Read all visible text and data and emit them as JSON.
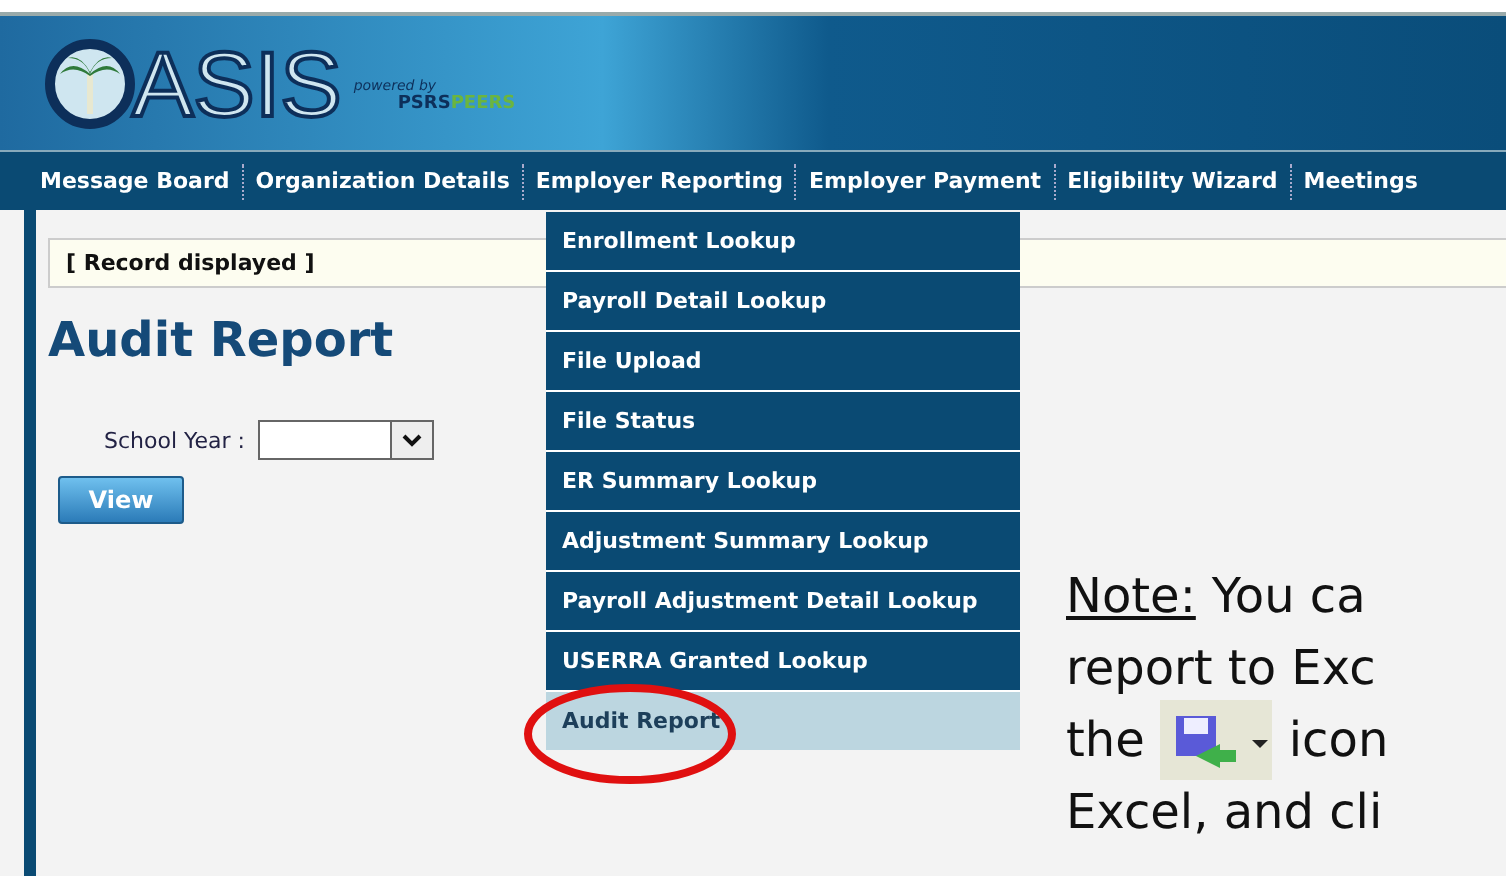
{
  "header": {
    "logo_text": "ASIS",
    "powered_by": "powered by",
    "partner_text_1": "PSRS",
    "partner_text_2": "PEERS"
  },
  "nav": [
    "Message Board",
    "Organization Details",
    "Employer Reporting",
    "Employer Payment",
    "Eligibility Wizard",
    "Meetings"
  ],
  "status_message": "[ Record displayed ]",
  "page_title": "Audit Report",
  "form": {
    "label": "School Year :",
    "button": "View"
  },
  "menu": [
    {
      "label": "Enrollment Lookup",
      "selected": false
    },
    {
      "label": "Payroll Detail Lookup",
      "selected": false
    },
    {
      "label": "File Upload",
      "selected": false
    },
    {
      "label": "File Status",
      "selected": false
    },
    {
      "label": "ER Summary Lookup",
      "selected": false
    },
    {
      "label": "Adjustment Summary Lookup",
      "selected": false
    },
    {
      "label": "Payroll Adjustment Detail Lookup",
      "selected": false
    },
    {
      "label": "USERRA Granted Lookup",
      "selected": false
    },
    {
      "label": "Audit Report",
      "selected": true
    }
  ],
  "note": {
    "label": "Note:",
    "line_1": "You ca",
    "line_2": "report to Exc",
    "line_3_before": "the",
    "line_3_after": "icon",
    "line_4": "Excel, and cli"
  }
}
